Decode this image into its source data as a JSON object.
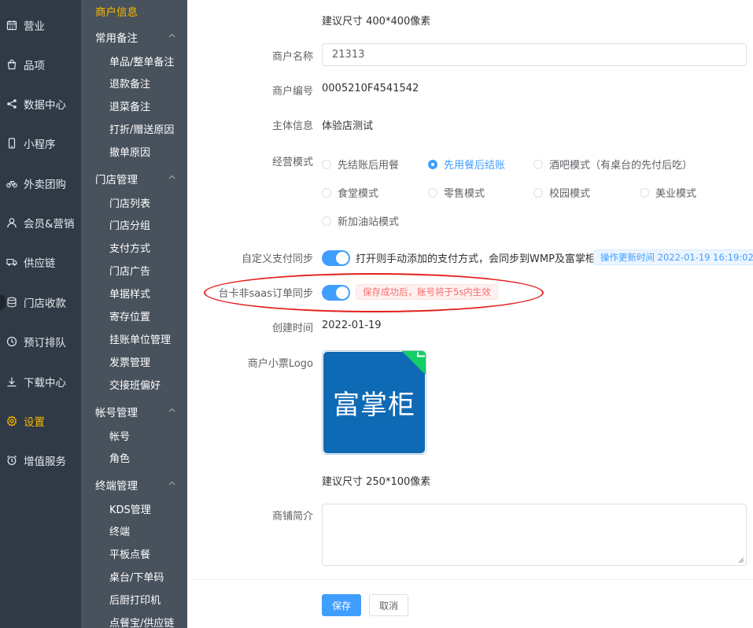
{
  "nav_primary": [
    {
      "label": "营业",
      "icon": "calendar-icon",
      "active": false
    },
    {
      "label": "品项",
      "icon": "bag-icon",
      "active": false
    },
    {
      "label": "数据中心",
      "icon": "share-icon",
      "active": false
    },
    {
      "label": "小程序",
      "icon": "phone-icon",
      "active": false
    },
    {
      "label": "外卖团购",
      "icon": "bike-icon",
      "active": false
    },
    {
      "label": "会员&营销",
      "icon": "user-icon",
      "active": false
    },
    {
      "label": "供应链",
      "icon": "truck-icon",
      "active": false
    },
    {
      "label": "门店收款",
      "icon": "database-icon",
      "active": false
    },
    {
      "label": "预订排队",
      "icon": "clock-icon",
      "active": false
    },
    {
      "label": "下载中心",
      "icon": "download-icon",
      "active": false
    },
    {
      "label": "设置",
      "icon": "gear-icon",
      "active": true
    },
    {
      "label": "增值服务",
      "icon": "alarm-icon",
      "active": false
    }
  ],
  "nav_secondary": {
    "title": "商户信息",
    "groups": [
      {
        "label": "常用备注",
        "items": [
          "单品/整单备注",
          "退款备注",
          "退菜备注",
          "打折/赠送原因",
          "撤单原因"
        ]
      },
      {
        "label": "门店管理",
        "items": [
          "门店列表",
          "门店分组",
          "支付方式",
          "门店广告",
          "单据样式",
          "寄存位置",
          "挂账单位管理",
          "发票管理",
          "交接班偏好"
        ]
      },
      {
        "label": "帐号管理",
        "items": [
          "帐号",
          "角色"
        ]
      },
      {
        "label": "终端管理",
        "items": [
          "KDS管理",
          "终端",
          "平板点餐",
          "桌台/下单码",
          "后厨打印机",
          "点餐宝/供应链"
        ]
      }
    ]
  },
  "form": {
    "top_hint": "建议尺寸 400*400像素",
    "merchant_name": {
      "label": "商户名称",
      "value": "21313"
    },
    "merchant_id": {
      "label": "商户编号",
      "value": "0005210F4541542"
    },
    "entity": {
      "label": "主体信息",
      "value": "体验店测试"
    },
    "mode": {
      "label": "经营模式",
      "options": [
        {
          "label": "先结账后用餐",
          "checked": false
        },
        {
          "label": "先用餐后结账",
          "checked": true
        },
        {
          "label": "酒吧模式（有桌台的先付后吃）",
          "checked": false
        },
        {
          "label": "食堂模式",
          "checked": false
        },
        {
          "label": "零售模式",
          "checked": false
        },
        {
          "label": "校园模式",
          "checked": false
        },
        {
          "label": "美业模式",
          "checked": false
        },
        {
          "label": "新加油站模式",
          "checked": false
        }
      ]
    },
    "custom_pay_sync": {
      "label": "自定义支付同步",
      "enabled": true,
      "desc": "打开则手动添加的支付方式，会同步到WMP及富掌柜",
      "tag": "操作更新时间 2022-01-19 16:19:02"
    },
    "non_saas_sync": {
      "label": "台卡非saas订单同步",
      "enabled": true,
      "tag": "保存成功后，账号将于5s内生效"
    },
    "created": {
      "label": "创建时间",
      "value": "2022-01-19"
    },
    "logo": {
      "label": "商户小票Logo",
      "text": "富掌柜",
      "hint": "建议尺寸 250*100像素"
    },
    "intro": {
      "label": "商铺简介",
      "value": ""
    },
    "save_label": "保存",
    "cancel_label": "取消"
  },
  "colors": {
    "primary": "#409eff",
    "active_nav": "#f7b900",
    "sidebar_dark": "#2f3a46",
    "sidebar_light": "#48525d",
    "annotation": "#e3201b",
    "logo_bg": "#0f6ab5"
  }
}
